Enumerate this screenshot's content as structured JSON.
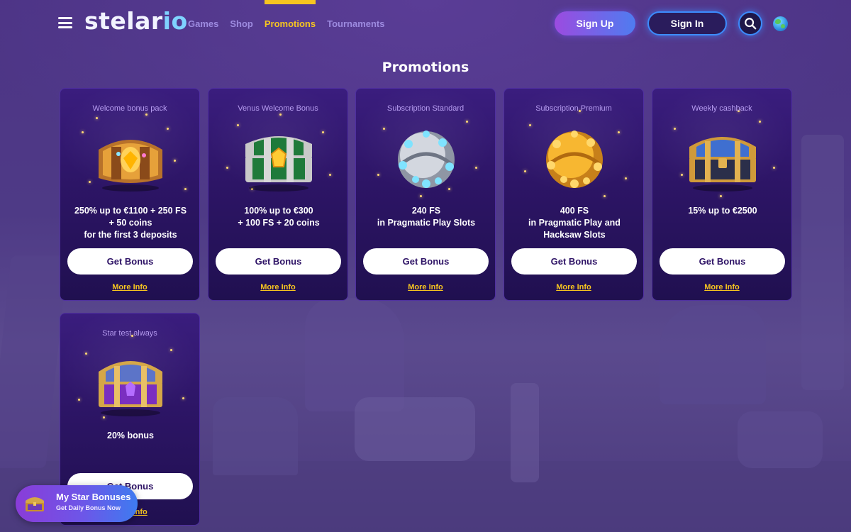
{
  "header": {
    "logo_text_main": "stelar",
    "logo_text_accent": "io",
    "nav": [
      {
        "label": "Games",
        "active": false
      },
      {
        "label": "Shop",
        "active": false
      },
      {
        "label": "Promotions",
        "active": true
      },
      {
        "label": "Tournaments",
        "active": false
      }
    ],
    "signup_label": "Sign Up",
    "signin_label": "Sign In",
    "icons": {
      "menu": "hamburger-icon",
      "search": "search-icon",
      "language": "globe-icon"
    }
  },
  "page": {
    "title": "Promotions"
  },
  "promotions": [
    {
      "title": "Welcome bonus pack",
      "desc": [
        "250% up to €1100 + 250 FS",
        "+ 50 coins",
        "for the first 3 deposits"
      ],
      "button": "Get Bonus",
      "more": "More Info",
      "art": "golden-treasure-chest"
    },
    {
      "title": "Venus Welcome Bonus",
      "desc": [
        "100% up to €300",
        "+ 100 FS + 20 coins"
      ],
      "button": "Get Bonus",
      "more": "More Info",
      "art": "green-treasure-chest"
    },
    {
      "title": "Subscription Standard",
      "desc": [
        "240 FS",
        "in Pragmatic Play Slots"
      ],
      "button": "Get Bonus",
      "more": "More Info",
      "art": "silver-gem-orb"
    },
    {
      "title": "Subscription Premium",
      "desc": [
        "400 FS",
        "in Pragmatic Play and",
        "Hacksaw Slots"
      ],
      "button": "Get Bonus",
      "more": "More Info",
      "art": "gold-gem-orb"
    },
    {
      "title": "Weekly cashback",
      "desc": [
        "15% up to €2500"
      ],
      "button": "Get Bonus",
      "more": "More Info",
      "art": "blue-treasure-chest"
    },
    {
      "title": "Star test always",
      "desc": [
        "20% bonus"
      ],
      "button": "Get Bonus",
      "more": "More Info",
      "art": "purple-treasure-chest"
    }
  ],
  "star_bonuses": {
    "title": "My Star Bonuses",
    "subtitle": "Get Daily Bonus Now",
    "icon": "treasure-chest-icon"
  },
  "colors": {
    "accent": "#f7c520",
    "nav": "#9d8be0",
    "card_bg": "#2d1566",
    "signin_border": "#3c8cff"
  }
}
